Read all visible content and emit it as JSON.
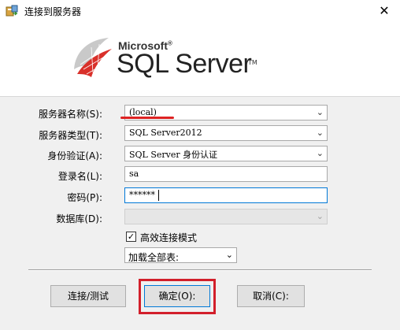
{
  "window": {
    "title": "连接到服务器",
    "close_glyph": "✕"
  },
  "banner": {
    "microsoft": "Microsoft",
    "microsoft_mark": "®",
    "product": "SQL Server",
    "tm": "TM"
  },
  "form": {
    "server_name_label": "服务器名称(S):",
    "server_name_value": "(local)",
    "server_type_label": "服务器类型(T):",
    "server_type_value": "SQL Server2012",
    "auth_label": "身份验证(A):",
    "auth_value": "SQL Server 身份认证",
    "login_label": "登录名(L):",
    "login_value": "sa",
    "password_label": "密码(P):",
    "password_value": "******",
    "database_label": "数据库(D):",
    "database_value": "",
    "fast_mode_label": "高效连接模式",
    "fast_mode_checked": true,
    "load_tables_value": "加载全部表:"
  },
  "buttons": {
    "connect_test": "连接/测试",
    "ok": "确定(O):",
    "cancel": "取消(C):"
  },
  "colors": {
    "highlight": "#d21f2b",
    "focus": "#0078d7"
  }
}
